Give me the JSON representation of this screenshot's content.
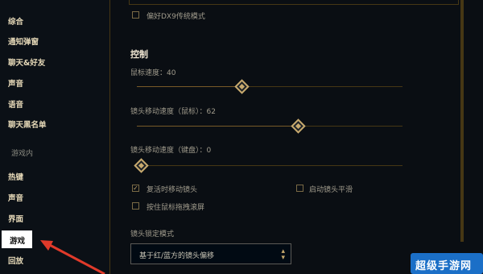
{
  "sidebar": {
    "items": [
      {
        "label": "综合"
      },
      {
        "label": "通知弹窗"
      },
      {
        "label": "聊天&好友"
      },
      {
        "label": "声音"
      },
      {
        "label": "语音"
      },
      {
        "label": "聊天黑名单"
      }
    ],
    "section_label": "游戏内",
    "ingame_items": [
      {
        "label": "热键"
      },
      {
        "label": "声音"
      },
      {
        "label": "界面"
      },
      {
        "label": "游戏"
      },
      {
        "label": "回放"
      }
    ]
  },
  "main": {
    "dx9_checkbox": {
      "label": "偏好DX9传统模式",
      "checked": false
    },
    "controls": {
      "title": "控制",
      "mouse_speed": {
        "label": "鼠标速度：40",
        "value": 40
      },
      "camera_speed_mouse": {
        "label": "镜头移动速度（鼠标）：62",
        "value": 62
      },
      "camera_speed_keyboard": {
        "label": "镜头移动速度（键盘）：0",
        "value": 0
      },
      "checkboxes": [
        {
          "label": "复活时移动镜头",
          "checked": true
        },
        {
          "label": "启动镜头平滑",
          "checked": false
        },
        {
          "label": "按住鼠标拖拽滚屏",
          "checked": false
        }
      ],
      "lock_mode": {
        "label": "镜头锁定模式",
        "selected": "基于红/蓝方的镜头偏移"
      }
    }
  },
  "watermark": {
    "text": "超级手游网"
  },
  "colors": {
    "gold": "#c8aa6e",
    "annotation_arrow": "#e03a2a"
  }
}
